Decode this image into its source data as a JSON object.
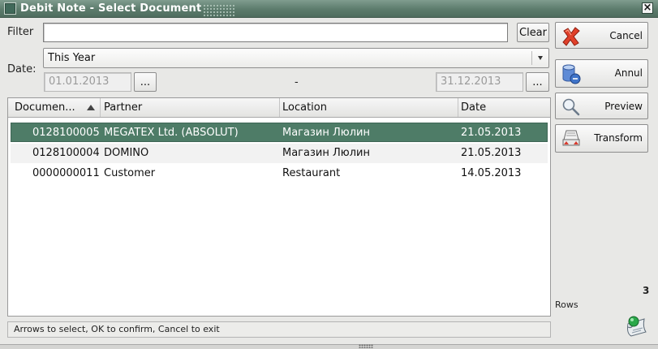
{
  "window": {
    "title": "Debit Note - Select Document",
    "close_glyph": "×"
  },
  "filter": {
    "label": "Filter",
    "value": "",
    "clear_label": "Clear"
  },
  "date": {
    "label": "Date:",
    "period": "This Year",
    "from": "01.01.2013",
    "to": "31.12.2013",
    "separator": "-",
    "picker_label": "..."
  },
  "table": {
    "columns": [
      "Documen...",
      "Partner",
      "Location",
      "Date"
    ],
    "rows": [
      {
        "document": "0128100005",
        "partner": "MEGATEX Ltd. (ABSOLUT)",
        "location": "Магазин Люлин",
        "date": "21.05.2013"
      },
      {
        "document": "0128100004",
        "partner": "DOMINO",
        "location": "Магазин Люлин",
        "date": "21.05.2013"
      },
      {
        "document": "0000000011",
        "partner": "Customer",
        "location": "Restaurant",
        "date": "14.05.2013"
      }
    ]
  },
  "actions": {
    "cancel": {
      "label": "Cancel",
      "icon": "red-x-icon"
    },
    "annul": {
      "label": "Annul",
      "icon": "database-icon"
    },
    "preview": {
      "label": "Preview",
      "icon": "magnifier-icon"
    },
    "transform": {
      "label": "Transform",
      "icon": "transform-icon"
    }
  },
  "rows_info": {
    "count": "3",
    "label": "Rows"
  },
  "status_text": "Arrows to select, OK to confirm, Cancel to exit",
  "colors": {
    "accent": "#4e7c67",
    "titlebar": "#5c7b6c"
  }
}
